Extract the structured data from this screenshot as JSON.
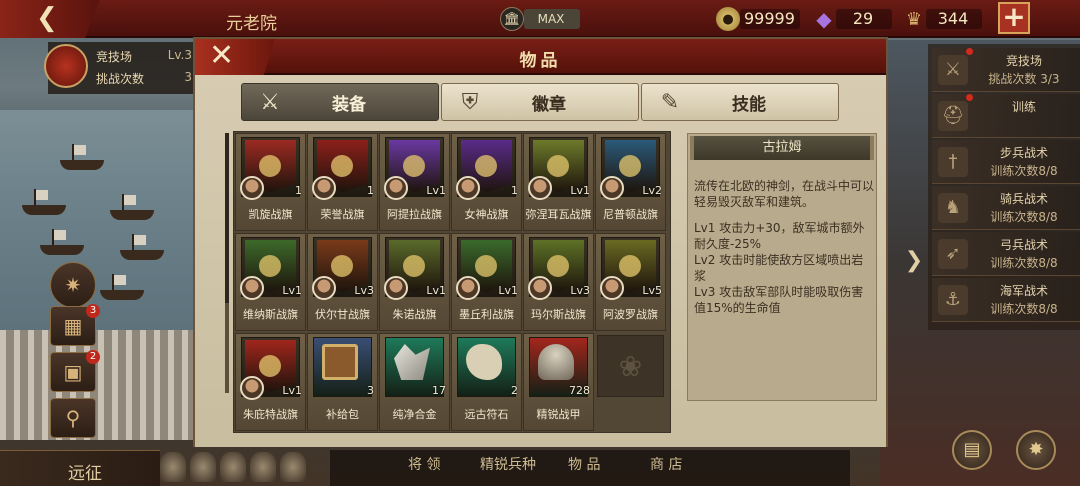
{
  "topbar": {
    "title": "元老院",
    "senate_level": "MAX",
    "gold": "99999",
    "gems": "29",
    "rank": "344"
  },
  "left": {
    "arena_label": "竞技场",
    "arena_value": "Lv.3",
    "challenges_label": "挑战次数",
    "challenges_value": "3",
    "badge_1": "3",
    "badge_2": "2",
    "expedition": "远征"
  },
  "dialog": {
    "title": "物品",
    "tabs": [
      {
        "label": "装备",
        "icon": "crossed-weapons-icon"
      },
      {
        "label": "徽章",
        "icon": "shield-badge-icon"
      },
      {
        "label": "技能",
        "icon": "scroll-icon"
      }
    ],
    "items": [
      {
        "name": "凯旋战旗",
        "level": "1",
        "color": "#9c2a22"
      },
      {
        "name": "荣誉战旗",
        "level": "1",
        "color": "#8c1f1a"
      },
      {
        "name": "阿提拉战旗",
        "level": "Lv1",
        "color": "#6a38a2"
      },
      {
        "name": "女神战旗",
        "level": "1",
        "color": "#5a2b8a"
      },
      {
        "name": "弥涅耳瓦战旗",
        "level": "Lv1",
        "color": "#6d7a2a"
      },
      {
        "name": "尼普顿战旗",
        "level": "Lv2",
        "color": "#2a5a7a"
      },
      {
        "name": "维纳斯战旗",
        "level": "Lv1",
        "color": "#3c6a2a"
      },
      {
        "name": "伏尔甘战旗",
        "level": "Lv3",
        "color": "#7a3a1a"
      },
      {
        "name": "朱诺战旗",
        "level": "Lv1",
        "color": "#5a6a2a"
      },
      {
        "name": "墨丘利战旗",
        "level": "Lv1",
        "color": "#3a6a2c"
      },
      {
        "name": "玛尔斯战旗",
        "level": "Lv3",
        "color": "#5d7226"
      },
      {
        "name": "阿波罗战旗",
        "level": "Lv5",
        "color": "#6a6a22"
      },
      {
        "name": "朱庇特战旗",
        "level": "Lv1",
        "color": "#a0261c"
      },
      {
        "name": "补给包",
        "level": "3",
        "color": "#3a4e74"
      },
      {
        "name": "纯净合金",
        "level": "17",
        "color": "#1e7a5a"
      },
      {
        "name": "远古符石",
        "level": "2",
        "color": "#1e7a5a"
      },
      {
        "name": "精锐战甲",
        "level": "728",
        "color": "#a3261c"
      }
    ],
    "detail": {
      "title": "古拉姆",
      "desc": "流传在北欧的神剑，在战斗中可以轻易毁灭敌军和建筑。",
      "lv1": "Lv1  攻击力+30，敌军城市额外耐久度-25%",
      "lv2": "Lv2  攻击时能使敌方区域喷出岩浆",
      "lv3": "Lv3  攻击敌军部队时能吸取伤害值15%的生命值"
    }
  },
  "right": {
    "items": [
      {
        "t1": "竞技场",
        "t2": "挑战次数 3/3",
        "icon": "crossed-swords-icon"
      },
      {
        "t1": "训练",
        "t2": "",
        "icon": "helmet-icon"
      },
      {
        "t1": "步兵战术",
        "t2": "训练次数8/8",
        "icon": "sword-icon"
      },
      {
        "t1": "骑兵战术",
        "t2": "训练次数8/8",
        "icon": "horse-icon"
      },
      {
        "t1": "弓兵战术",
        "t2": "训练次数8/8",
        "icon": "bow-icon"
      },
      {
        "t1": "海军战术",
        "t2": "训练次数8/8",
        "icon": "anchor-icon"
      }
    ]
  },
  "bottombar": {
    "b1": "将 领",
    "b2": "精锐兵种",
    "b3": "物 品",
    "b4": "商 店"
  }
}
